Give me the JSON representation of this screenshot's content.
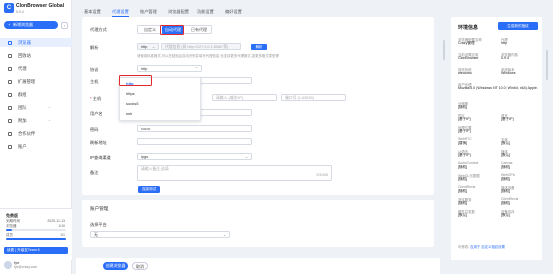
{
  "app": {
    "name": "ClonBrowser Global",
    "version": "5.9.4",
    "logo": "C"
  },
  "sidebar": {
    "new_button": "新增浏览器",
    "items": [
      {
        "label": "浏览器",
        "active": true
      },
      {
        "label": "回收站",
        "active": false
      },
      {
        "label": "代理",
        "active": false
      },
      {
        "label": "扩展管理",
        "active": false
      },
      {
        "label": "群组",
        "active": false
      },
      {
        "label": "团队",
        "active": false
      },
      {
        "label": "附加",
        "active": false
      },
      {
        "label": "合作伙伴",
        "active": false
      },
      {
        "label": "账户",
        "active": false
      }
    ],
    "plan": {
      "title": "免费版",
      "expire_label": "到期时间",
      "expire_value": "2025-11-13",
      "profiles_label": "浏览器",
      "profiles_value": "1/10",
      "members_label": "成员",
      "members_value": "1/1",
      "profiles_fill": 0.1,
      "members_fill": 1.0,
      "renew": "续费 | 升级至Team 5"
    },
    "user": {
      "name": "fye",
      "email": "fye@crazy.com"
    }
  },
  "tabs": [
    "基本设置",
    "代理设置",
    "账户管理",
    "浏览器配置",
    "功能设置",
    "偏好设置"
  ],
  "active_tab": 1,
  "form": {
    "proxy_method_label": "代理方式",
    "proxy_modes": [
      "自定义",
      "自动代理",
      "已有代理"
    ],
    "parser_label": "解析",
    "parser_value": "http",
    "parser_placeholder": "代理信息 (如 http://127.0.0.1:8080 等)",
    "parser_hint": "请使用标准格式,可以在粘贴后自动识别并填写代理信息,也支持更多代理格式,如更多格式类型需",
    "parse_button": "解析",
    "protocol_label": "协议",
    "protocol_value": "http",
    "host_label": "主机",
    "port_label": "主机",
    "host_placeholder": "请输入 (域名/IP)",
    "port_placeholder": "端口号 (1-65535)",
    "username_label": "用户名",
    "password_label": "密码",
    "password_value": "•••••••",
    "refresh_label": "刷新地址",
    "ip_query_label": "IP查询渠道",
    "ip_query_value": "ipgo",
    "note_label": "备注",
    "note_placeholder": "请输入备注,选填",
    "note_counter": "0/1000",
    "check_button": "连接测试",
    "dropdown_options": [
      "http",
      "https",
      "socks5",
      "ssh"
    ],
    "dropdown_selected": 0
  },
  "account": {
    "title": "账户管理",
    "platform_label": "选择平台",
    "platform_value": "无"
  },
  "footer": {
    "ok": "创建浏览器",
    "cancel": "取消"
  },
  "env": {
    "title": "环境信息",
    "generate": "生成新的指纹",
    "rows": [
      [
        "浏览器配置名称",
        "Crazy管理",
        "代理",
        "http"
      ],
      [
        "当前设置应用",
        "ClonBrowser",
        "浏览器内核",
        "5.9.4"
      ],
      [
        "操作系统",
        "windows",
        "系统版本",
        "Windows"
      ],
      [
        "用户代理",
        "Mozilla/5.0 (Windows NT 10.0; Win64; x64) Apple...",
        "",
        ""
      ],
      [
        "分辨率",
        "[随机]",
        "",
        ""
      ],
      [
        "时区",
        "[基于IP]",
        "语言",
        "[基于IP]"
      ],
      [
        "地理位置",
        "[基于IP]",
        "",
        ""
      ],
      [
        "WebRTC",
        "[替换]",
        "字体",
        "[默认]"
      ],
      [
        "UI语言",
        "[基于IP]",
        "媒体",
        "[默认]"
      ],
      [
        "AudioContext",
        "[随机]",
        "Canvas",
        "[随机]"
      ],
      [
        "WebGL元数据",
        "[随机]",
        "WebGPU",
        "[随机]"
      ],
      [
        "ClientRects",
        "[随机]",
        "媒体设备",
        "[随机]"
      ],
      [
        "测试服务",
        "[随机]",
        "ClientRects",
        "[随机]"
      ],
      [
        "硬件并发数",
        "[默认]",
        "设备内存",
        "[默认]"
      ]
    ],
    "note": "可修改:",
    "note_link": "应用于 自定义指纹设置"
  }
}
